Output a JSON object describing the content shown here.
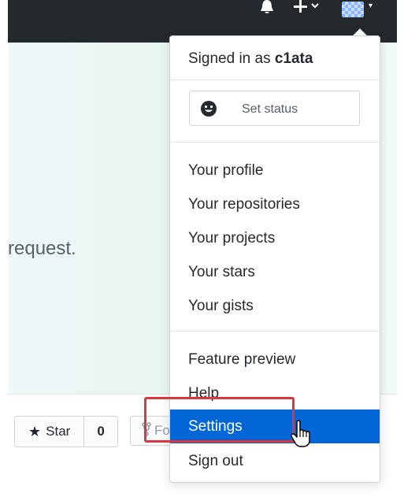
{
  "hero": {
    "text": "request."
  },
  "repo_actions": {
    "star_label": "Star",
    "star_count": "0",
    "fork_label": "Fo"
  },
  "user_menu": {
    "signed_in_prefix": "Signed in as",
    "username": "c1ata",
    "set_status_label": "Set status",
    "items": [
      {
        "label": "Your profile"
      },
      {
        "label": "Your repositories"
      },
      {
        "label": "Your projects"
      },
      {
        "label": "Your stars"
      },
      {
        "label": "Your gists"
      },
      {
        "label": "Feature preview"
      },
      {
        "label": "Help"
      },
      {
        "label": "Settings",
        "active": true
      },
      {
        "label": "Sign out"
      }
    ]
  },
  "colors": {
    "header_bg": "#24292e",
    "active_item_bg": "#0366d6",
    "highlight_box": "#d9363e"
  }
}
